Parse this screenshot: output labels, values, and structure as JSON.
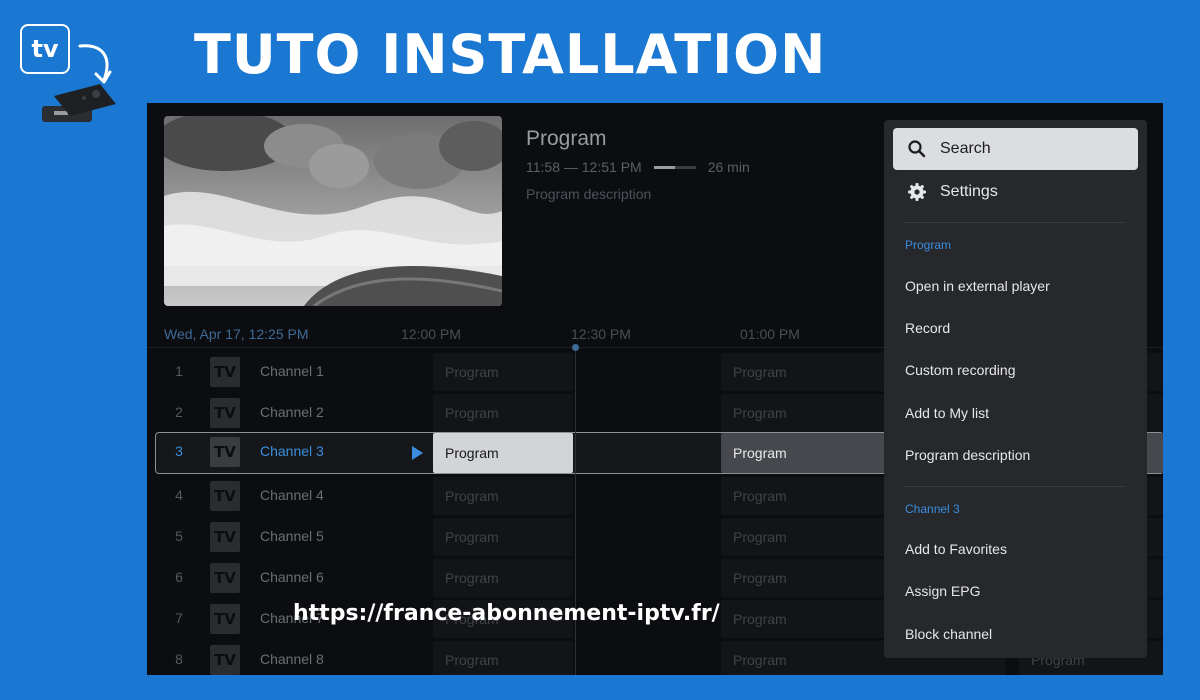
{
  "banner": {
    "logo_text": "tv",
    "title": "TUTO INSTALLATION",
    "url": "https://france-abonnement-iptv.fr/"
  },
  "colors": {
    "background": "#1a78d2",
    "accent": "#3b8ede",
    "menu_bg": "#26282c",
    "screen_bg": "#0c0d10"
  },
  "preview": {
    "title": "Program",
    "time_range": "11:58 — 12:51 PM",
    "progress": 0.5,
    "duration": "26 min",
    "description": "Program description"
  },
  "guide": {
    "date": "Wed, Apr 17, 12:25 PM",
    "times": [
      "12:00 PM",
      "12:30 PM",
      "01:00 PM"
    ],
    "logo_text": "TV",
    "selected_index": 2,
    "channels": [
      {
        "num": "1",
        "name": "Channel 1",
        "programs": [
          "Program",
          "Program",
          "Program"
        ]
      },
      {
        "num": "2",
        "name": "Channel 2",
        "programs": [
          "Program",
          "Program",
          "Program"
        ]
      },
      {
        "num": "3",
        "name": "Channel 3",
        "programs": [
          "Program",
          "Program",
          "Program"
        ]
      },
      {
        "num": "4",
        "name": "Channel 4",
        "programs": [
          "Program",
          "Program",
          "Program"
        ]
      },
      {
        "num": "5",
        "name": "Channel 5",
        "programs": [
          "Program",
          "Program",
          "Program"
        ]
      },
      {
        "num": "6",
        "name": "Channel 6",
        "programs": [
          "Program",
          "Program",
          "Program"
        ]
      },
      {
        "num": "7",
        "name": "Channel 7",
        "programs": [
          "Program",
          "Program",
          "Program"
        ]
      },
      {
        "num": "8",
        "name": "Channel 8",
        "programs": [
          "Program",
          "Program",
          "Program"
        ]
      }
    ]
  },
  "menu": {
    "search_label": "Search",
    "settings_label": "Settings",
    "program_section": "Program",
    "program_items": [
      "Open in external player",
      "Record",
      "Custom recording",
      "Add to My list",
      "Program description"
    ],
    "channel_section": "Channel 3",
    "channel_items": [
      "Add to Favorites",
      "Assign EPG",
      "Block channel"
    ],
    "search_icon": "search-icon",
    "settings_icon": "gear-icon"
  }
}
